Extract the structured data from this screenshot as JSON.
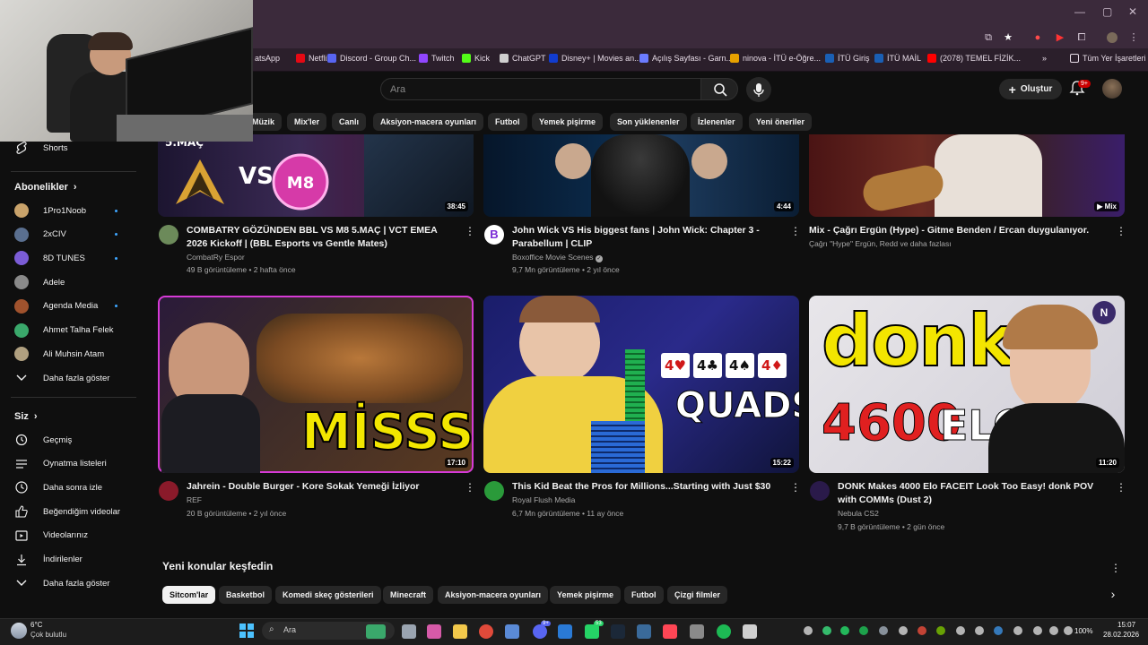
{
  "bookmarks": [
    {
      "label": "atsApp",
      "icon": "whatsapp-icon",
      "color": "#25d366"
    },
    {
      "label": "Netflix",
      "icon": "netflix-icon",
      "color": "#e50914"
    },
    {
      "label": "Discord - Group Ch...",
      "icon": "discord-icon",
      "color": "#5865f2"
    },
    {
      "label": "Twitch",
      "icon": "twitch-icon",
      "color": "#9146ff"
    },
    {
      "label": "Kick",
      "icon": "kick-icon",
      "color": "#53fc18"
    },
    {
      "label": "ChatGPT",
      "icon": "chatgpt-icon",
      "color": "#cfcfcf"
    },
    {
      "label": "Disney+ | Movies an...",
      "icon": "disney-icon",
      "color": "#113ccf"
    },
    {
      "label": "Açılış Sayfası - Garn...",
      "icon": "garnet-icon",
      "color": "#6b7cff"
    },
    {
      "label": "ninova - İTÜ e-Öğre...",
      "icon": "ninova-icon",
      "color": "#e6a100"
    },
    {
      "label": "İTÜ Giriş",
      "icon": "itu-icon",
      "color": "#1a5fb4"
    },
    {
      "label": "İTÜ MAİL",
      "icon": "itu-mail-icon",
      "color": "#1a5fb4"
    },
    {
      "label": "(2078) TEMEL FİZİK...",
      "icon": "youtube-icon",
      "color": "#ff0000"
    }
  ],
  "bookmarks_more": "»",
  "bookmarks_all": "Tüm Yer İşaretleri",
  "search": {
    "placeholder": "Ara"
  },
  "header": {
    "create_label": "Oluştur",
    "notif_badge": "9+"
  },
  "chips": [
    "Müzik",
    "Mix'ler",
    "Canlı",
    "Aksiyon-macera oyunları",
    "Futbol",
    "Yemek pişirme",
    "Son yüklenenler",
    "İzlenenler",
    "Yeni öneriler"
  ],
  "sidebar": {
    "shorts": "Shorts",
    "subs_heading": "Abonelikler",
    "subs": [
      {
        "name": "1Pro1Noob",
        "color": "#c9a36b",
        "live": true
      },
      {
        "name": "2xCIV",
        "color": "#5a6f8f",
        "live": true
      },
      {
        "name": "8D TUNES",
        "color": "#7b5cd6",
        "live": true
      },
      {
        "name": "Adele",
        "color": "#8a8a8a",
        "live": false
      },
      {
        "name": "Agenda Media",
        "color": "#a0522d",
        "live": true
      },
      {
        "name": "Ahmet Talha Felek",
        "color": "#3aa86b",
        "live": false
      },
      {
        "name": "Ali Muhsin Atam",
        "color": "#b0a080",
        "live": false
      }
    ],
    "show_more": "Daha fazla göster",
    "you_heading": "Siz",
    "you_items": [
      {
        "label": "Geçmiş",
        "icon": "history-icon"
      },
      {
        "label": "Oynatma listeleri",
        "icon": "playlists-icon"
      },
      {
        "label": "Daha sonra izle",
        "icon": "watch-later-icon"
      },
      {
        "label": "Beğendiğim videolar",
        "icon": "liked-icon"
      },
      {
        "label": "Videolarınız",
        "icon": "your-videos-icon"
      },
      {
        "label": "İndirilenler",
        "icon": "downloads-icon"
      },
      {
        "label": "Daha fazla göster",
        "icon": "chevron-down-icon"
      }
    ]
  },
  "videos_top": [
    {
      "title": "COMBATRY GÖZÜNDEN BBL VS M8 5.MAÇ | VCT EMEA 2026 Kickoff | (BBL Esports vs Gentle Mates)",
      "channel": "CombatRy Espor",
      "meta": "49 B görüntüleme • 2 hafta önce",
      "duration": "38:45",
      "thumb_text": "5.MAÇ",
      "vs": "VS"
    },
    {
      "title": "John Wick VS His biggest fans | John Wick: Chapter 3 - Parabellum | CLIP",
      "channel": "Boxoffice Movie Scenes",
      "meta": "9,7 Mn görüntüleme • 2 yıl önce",
      "duration": "4:44",
      "avatar_letter": "B"
    },
    {
      "title": "Mix - Çağrı Ergün (Hype) - Gitme Benden / Ercan duygulanıyor.",
      "channel": "Çağrı \"Hype\" Ergün, Redd ve daha fazlası",
      "meta": "",
      "duration": "Mix"
    }
  ],
  "videos_bottom": [
    {
      "title": "Jahrein - Double Burger - Kore Sokak Yemeği İzliyor",
      "channel": "REF",
      "meta": "20 B görüntüleme • 2 yıl önce",
      "duration": "17:10",
      "thumb_text": "MİSSS"
    },
    {
      "title": "This Kid Beat the Pros for Millions...Starting with Just $30",
      "channel": "Royal Flush Media",
      "meta": "6,7 Mn görüntüleme • 11 ay önce",
      "duration": "15:22",
      "thumb_text": "QUADS!",
      "cards": [
        "4♥",
        "4♣",
        "4♠",
        "4♦"
      ]
    },
    {
      "title": "DONK Makes 4000 Elo FACEIT Look Too Easy! donk POV with COMMs (Dust 2)",
      "channel": "Nebula CS2",
      "meta": "9,7 B görüntüleme • 2 gün önce",
      "duration": "11:20",
      "thumb_text": "donk",
      "thumb_num": "4600",
      "thumb_elo": "ELO"
    }
  ],
  "explore": {
    "title": "Yeni konular keşfedin",
    "chips": [
      "Sitcom'lar",
      "Basketbol",
      "Komedi skeç gösterileri",
      "Minecraft",
      "Aksiyon-macera oyunları",
      "Yemek pişirme",
      "Futbol",
      "Çizgi filmler"
    ]
  },
  "taskbar": {
    "weather_temp": "6°C",
    "weather_desc": "Çok bulutlu",
    "search": "Ara",
    "battery": "100%",
    "time": "15:07",
    "date": "28.02.2026",
    "discord_badge": "9+",
    "whatsapp_badge": "53"
  }
}
